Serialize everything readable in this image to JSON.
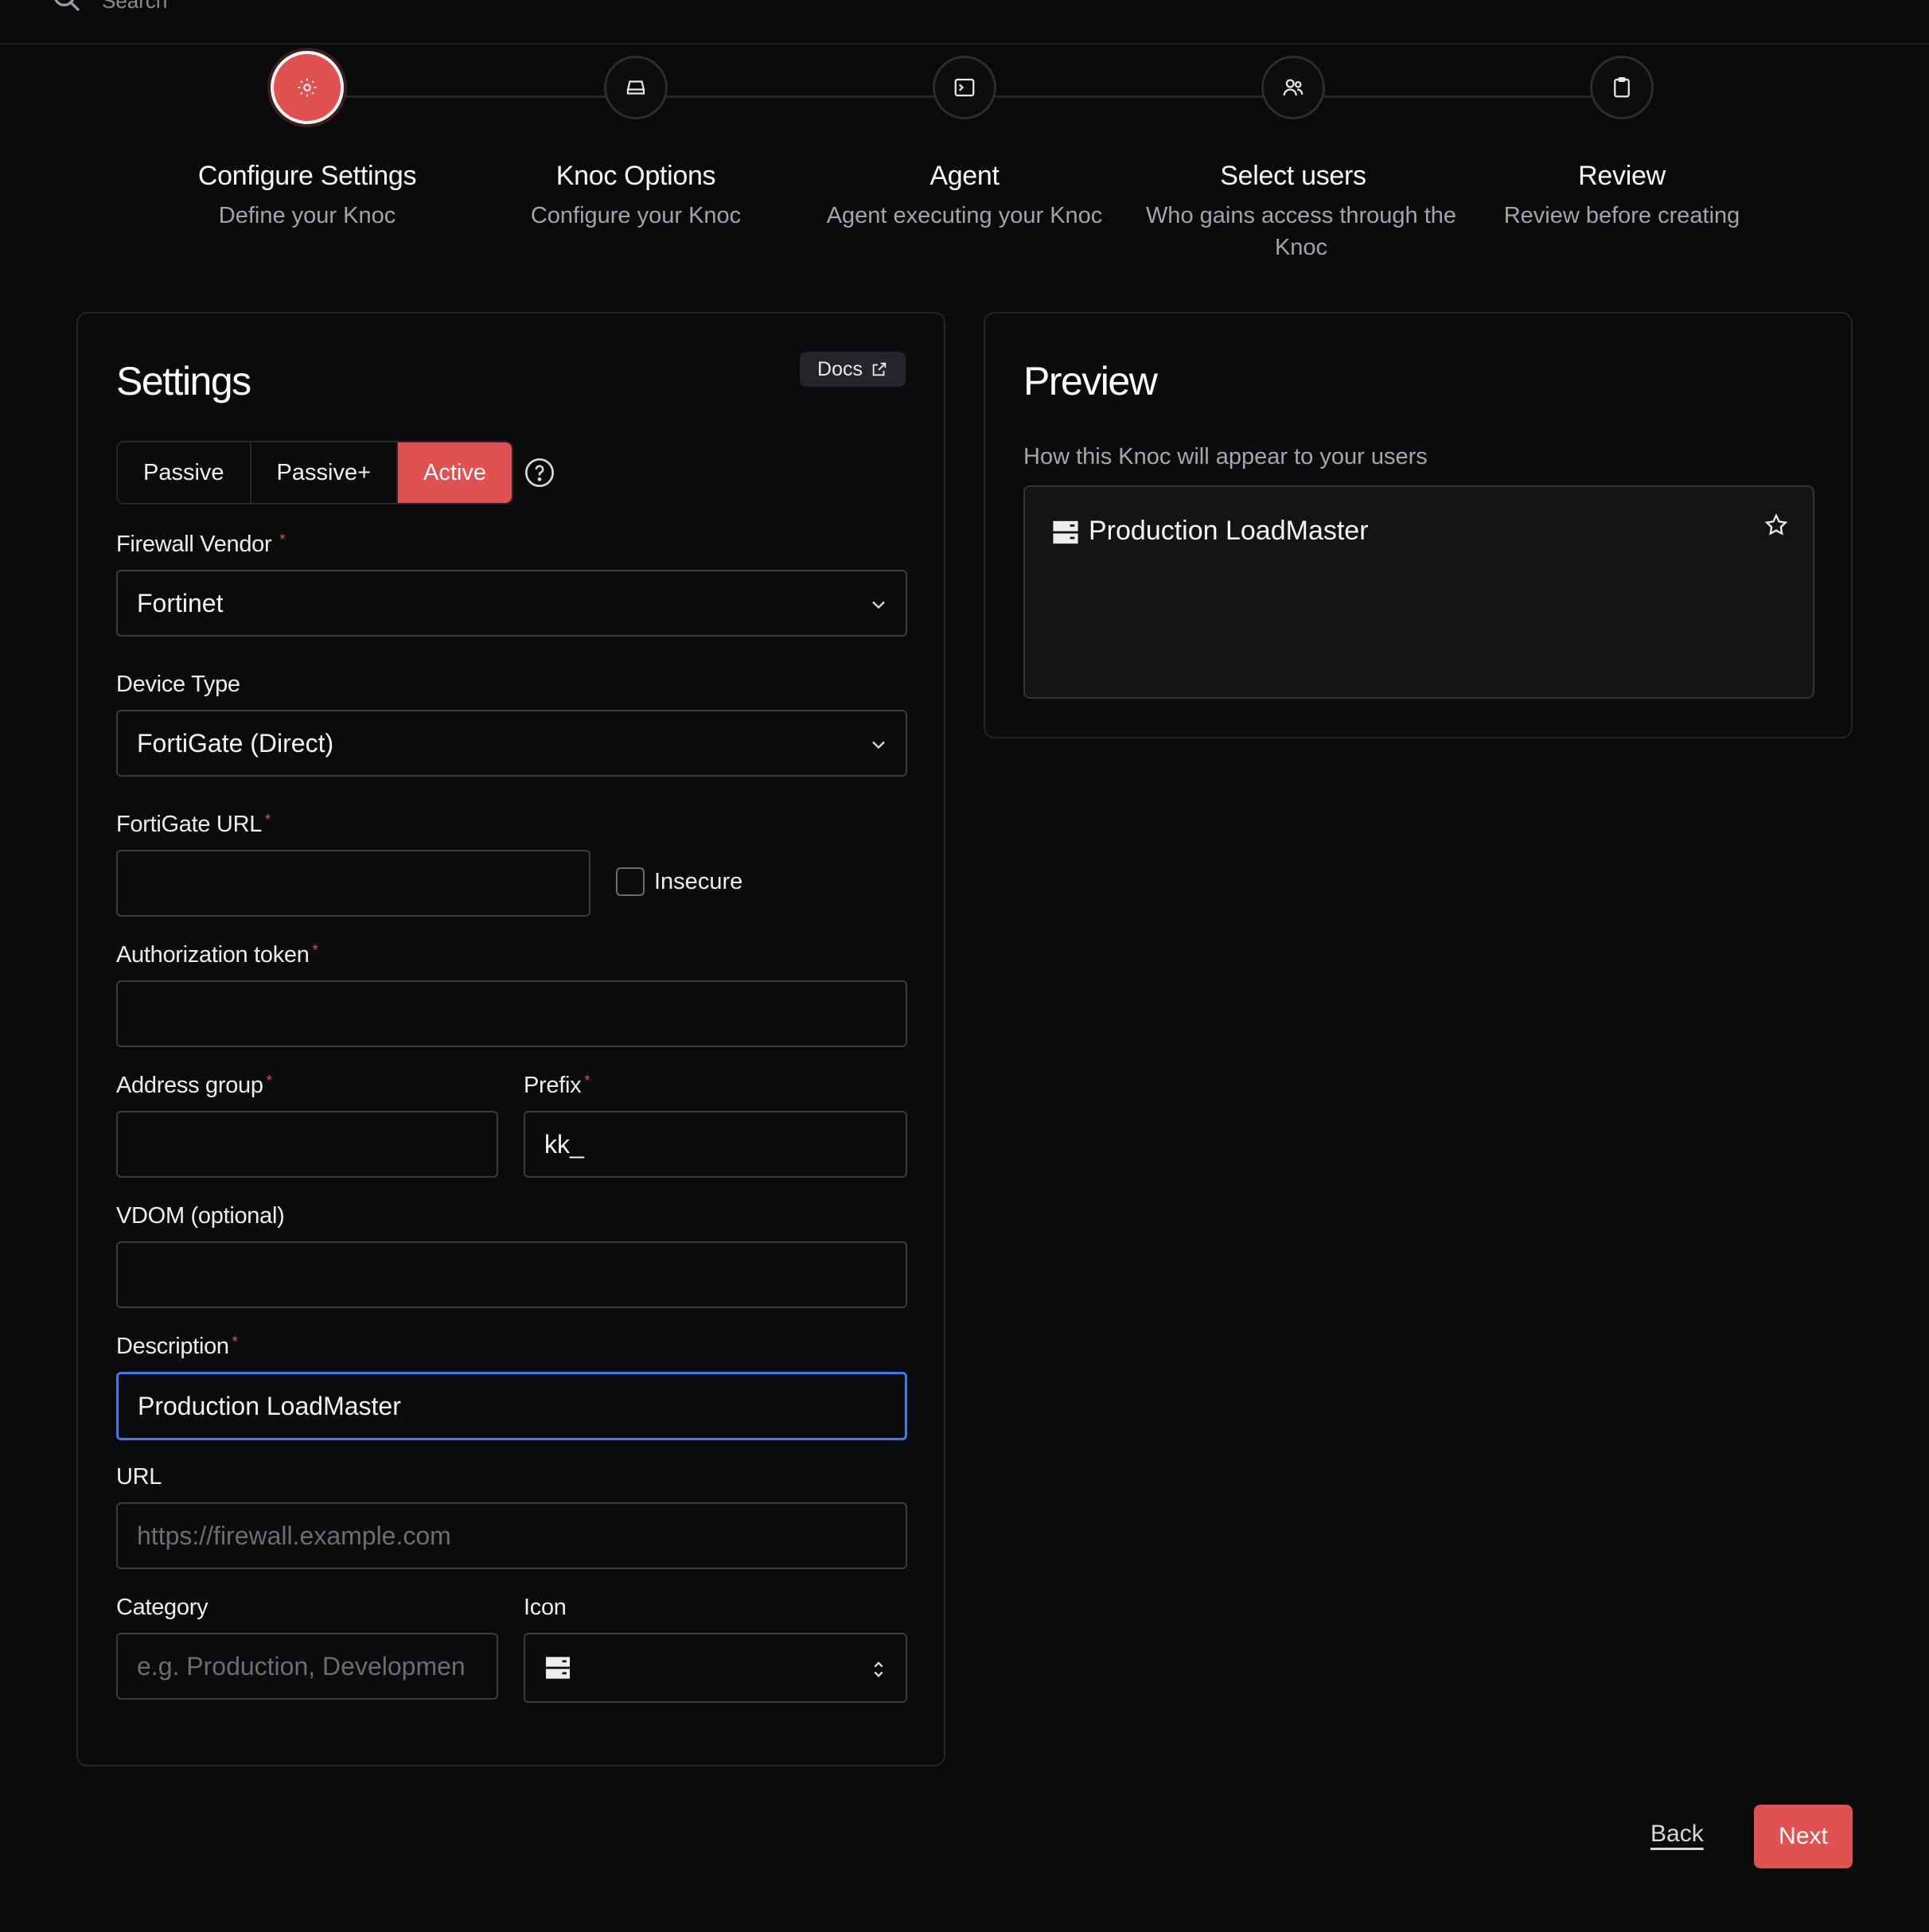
{
  "topbar": {
    "search_text": "Search"
  },
  "stepper": {
    "steps": [
      {
        "title": "Configure Settings",
        "subtitle": "Define your Knoc",
        "icon": "gear-icon",
        "active": true
      },
      {
        "title": "Knoc Options",
        "subtitle": "Configure your Knoc",
        "icon": "drive-icon",
        "active": false
      },
      {
        "title": "Agent",
        "subtitle": "Agent executing your Knoc",
        "icon": "terminal-icon",
        "active": false
      },
      {
        "title": "Select users",
        "subtitle": "Who gains access through the Knoc",
        "icon": "users-icon",
        "active": false
      },
      {
        "title": "Review",
        "subtitle": "Review before creating",
        "icon": "clipboard-icon",
        "active": false
      }
    ]
  },
  "settings": {
    "title": "Settings",
    "docs_label": "Docs",
    "modes": [
      "Passive",
      "Passive+",
      "Active"
    ],
    "selected_mode": "Active",
    "firewall_vendor": {
      "label": "Firewall Vendor",
      "value": "Fortinet"
    },
    "device_type": {
      "label": "Device Type",
      "value": "FortiGate (Direct)"
    },
    "fortigate_url": {
      "label": "FortiGate URL",
      "value": "",
      "insecure_label": "Insecure",
      "insecure_checked": false
    },
    "auth_token": {
      "label": "Authorization token",
      "value": ""
    },
    "address_group": {
      "label": "Address group",
      "value": ""
    },
    "prefix": {
      "label": "Prefix",
      "value": "kk_"
    },
    "vdom": {
      "label": "VDOM (optional)",
      "value": ""
    },
    "description": {
      "label": "Description",
      "value": "Production LoadMaster"
    },
    "url": {
      "label": "URL",
      "placeholder": "https://firewall.example.com"
    },
    "category": {
      "label": "Category",
      "placeholder": "e.g. Production, Developmen"
    },
    "icon": {
      "label": "Icon",
      "value": "server-icon"
    }
  },
  "preview": {
    "title": "Preview",
    "subtitle": "How this Knoc will appear to your users",
    "card_title": "Production LoadMaster"
  },
  "footer": {
    "back_label": "Back",
    "next_label": "Next"
  },
  "colors": {
    "accent": "#e05252",
    "focus": "#3b7bf0",
    "background": "#0a0a0c"
  }
}
